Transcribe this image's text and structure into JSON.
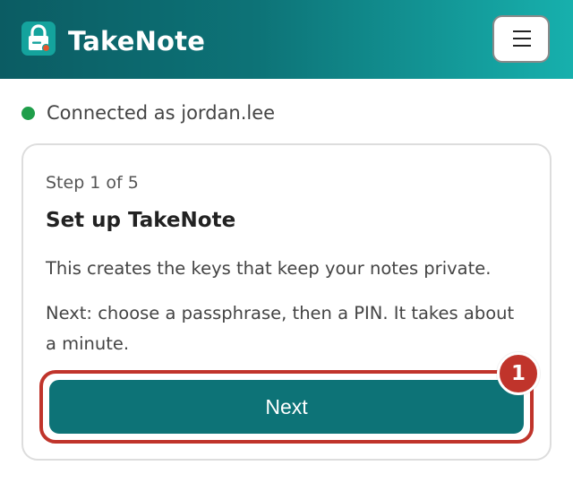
{
  "header": {
    "app_title": "TakeNote",
    "logo_icon": "lock-icon",
    "menu_icon": "hamburger-menu-icon",
    "menu_label": "Menu"
  },
  "status": {
    "text": "Connected as jordan.lee",
    "state": "connected",
    "color": "#1f9e4a"
  },
  "setup_card": {
    "step": "Step 1 of 5",
    "current_step": 1,
    "total_steps": 5,
    "title": "Set up TakeNote",
    "description": "This creates the keys that keep your notes private.",
    "next_info": "Next: choose a passphrase, then a PIN. It takes about a minute.",
    "next_button": "Next"
  },
  "annotation": {
    "badge": "1"
  },
  "colors": {
    "brand": "#0d7377",
    "header_gradient_end": "#17b0ad",
    "annotation_red": "#c0342b"
  }
}
